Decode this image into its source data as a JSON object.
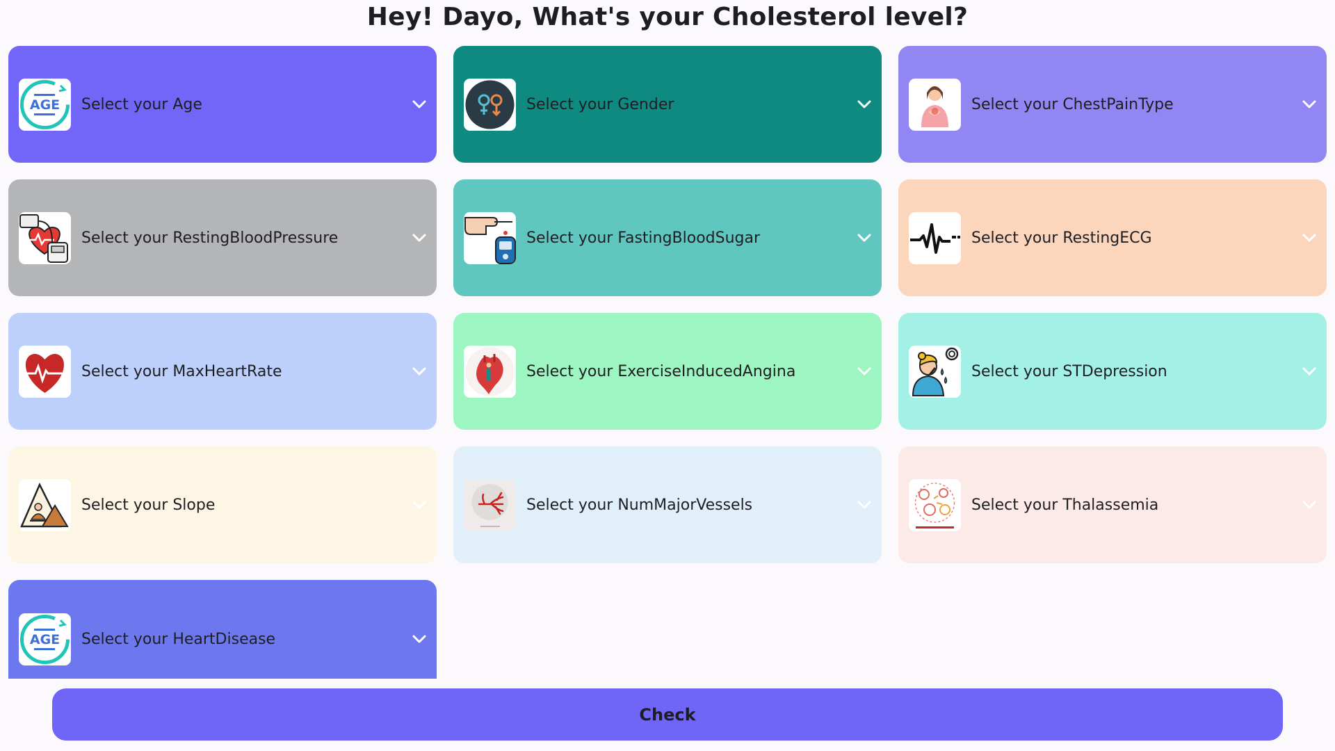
{
  "page": {
    "title": "Hey! Dayo, What's your Cholesterol level?"
  },
  "cards": [
    {
      "label": "Select your Age",
      "icon": "age-icon",
      "color": "#7166f7"
    },
    {
      "label": "Select your Gender",
      "icon": "gender-icon",
      "color": "#0f8a80"
    },
    {
      "label": "Select your ChestPainType",
      "icon": "chest-pain-icon",
      "color": "#9186f2"
    },
    {
      "label": "Select your RestingBloodPressure",
      "icon": "blood-pressure-icon",
      "color": "#b4b5b6"
    },
    {
      "label": "Select your FastingBloodSugar",
      "icon": "glucose-meter-icon",
      "color": "#5fc7bf"
    },
    {
      "label": "Select your RestingECG",
      "icon": "ecg-icon",
      "color": "#fbd6bd"
    },
    {
      "label": "Select your MaxHeartRate",
      "icon": "heart-rate-icon",
      "color": "#bdcffb"
    },
    {
      "label": "Select your ExerciseInducedAngina",
      "icon": "heart-anatomy-icon",
      "color": "#9df5c2"
    },
    {
      "label": "Select your STDepression",
      "icon": "stressed-person-icon",
      "color": "#a3f1e6"
    },
    {
      "label": "Select your Slope",
      "icon": "slope-icon",
      "color": "#fdf6e4"
    },
    {
      "label": "Select your NumMajorVessels",
      "icon": "blood-vessels-icon",
      "color": "#e1effb"
    },
    {
      "label": "Select your Thalassemia",
      "icon": "thalassemia-icon",
      "color": "#fceae8"
    },
    {
      "label": "Select your HeartDisease",
      "icon": "age-icon",
      "color": "#6e78ee"
    }
  ],
  "check_button": {
    "label": "Check",
    "color": "#6f66f7"
  }
}
